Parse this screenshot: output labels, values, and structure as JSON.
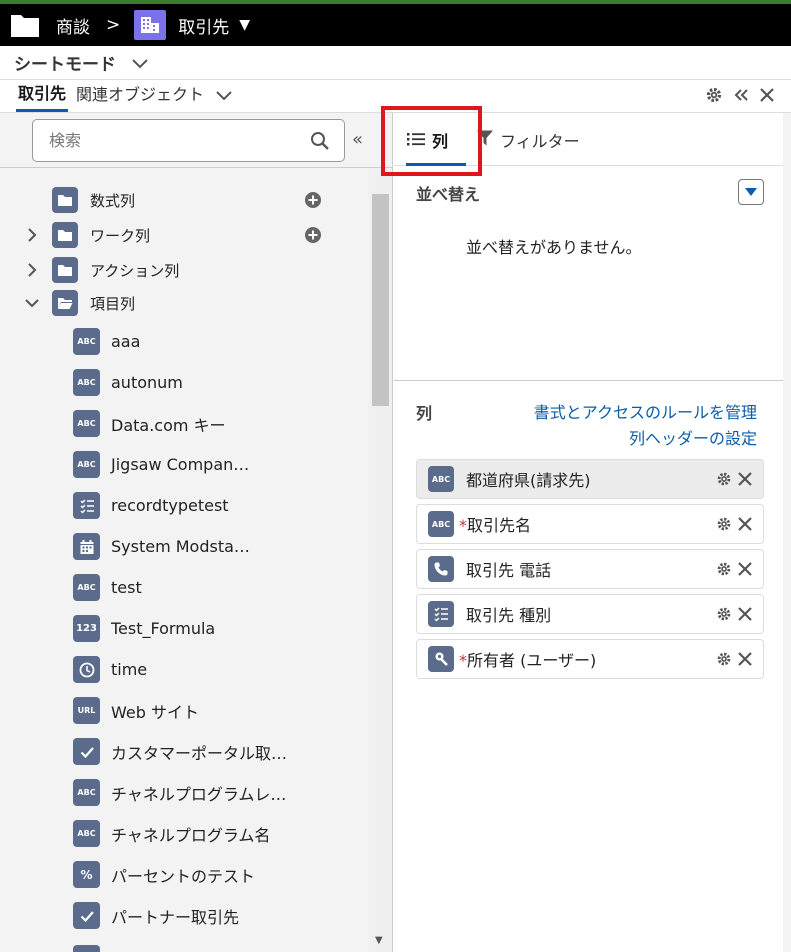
{
  "header": {
    "crumb": "商談",
    "sep": ">",
    "object": "取引先",
    "caret": "▼"
  },
  "mode": {
    "label": "シートモード"
  },
  "tabs": {
    "primary": "取引先",
    "related": "関連オブジェクト"
  },
  "search": {
    "placeholder": "検索",
    "collapse": "«"
  },
  "tree": {
    "folders": [
      {
        "label": "数式列",
        "expandable": false,
        "add": true
      },
      {
        "label": "ワーク列",
        "expandable": true,
        "add": true
      },
      {
        "label": "アクション列",
        "expandable": true,
        "add": false
      },
      {
        "label": "項目列",
        "expandable": true,
        "expanded": true,
        "add": false
      }
    ],
    "fields": [
      {
        "icon": "ABC",
        "label": "aaa"
      },
      {
        "icon": "ABC",
        "label": "autonum"
      },
      {
        "icon": "ABC",
        "label": "Data.com キー"
      },
      {
        "icon": "ABC",
        "label": "Jigsaw Compan…"
      },
      {
        "icon": "picklist",
        "label": "recordtypetest"
      },
      {
        "icon": "calendar",
        "label": "System Modsta…"
      },
      {
        "icon": "ABC",
        "label": "test"
      },
      {
        "icon": "123",
        "label": "Test_Formula"
      },
      {
        "icon": "clock",
        "label": "time"
      },
      {
        "icon": "URL",
        "label": "Web サイト"
      },
      {
        "icon": "check",
        "label": "カスタマーポータル取…"
      },
      {
        "icon": "ABC",
        "label": "チャネルプログラムレ…"
      },
      {
        "icon": "ABC",
        "label": "チャネルプログラム名"
      },
      {
        "icon": "%",
        "label": "パーセントのテスト"
      },
      {
        "icon": "check",
        "label": "パートナー取引先"
      }
    ]
  },
  "right": {
    "tab_columns": "列",
    "tab_filter": "フィルター",
    "sort_title": "並べ替え",
    "sort_empty": "並べ替えがありません。",
    "columns_title": "列",
    "link_rules": "書式とアクセスのルールを管理",
    "link_header": "列ヘッダーの設定",
    "columns": [
      {
        "icon": "ABC",
        "required": false,
        "label": "都道府県(請求先)",
        "selected": true
      },
      {
        "icon": "ABC",
        "required": true,
        "label": "取引先名",
        "selected": false
      },
      {
        "icon": "phone",
        "required": false,
        "label": "取引先 電話",
        "selected": false
      },
      {
        "icon": "picklist",
        "required": false,
        "label": "取引先 種別",
        "selected": false
      },
      {
        "icon": "lookup",
        "required": true,
        "label": "所有者 (ユーザー)",
        "selected": false
      }
    ],
    "required_mark": "*"
  },
  "colors": {
    "accent": "#0b5cab",
    "icon_bg": "#5a6b8c",
    "highlight": "#e0161d",
    "object_icon": "#7b72e9"
  }
}
